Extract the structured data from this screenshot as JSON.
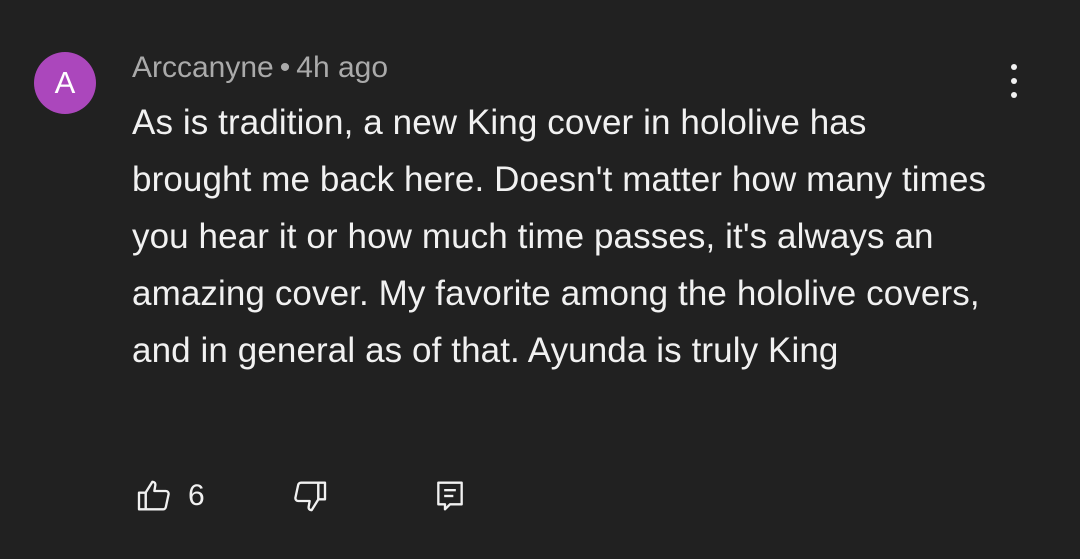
{
  "comment": {
    "avatar_letter": "A",
    "avatar_color": "#ab47bc",
    "author": "Arccanyne",
    "separator": "•",
    "time": "4h ago",
    "text": "As is tradition, a new King cover in hololive has brought me back here. Doesn't matter how many times you hear it or how much time passes, it's always an amazing cover. My favorite among the hololive covers, and in general as of that. Ayunda is truly King",
    "like_count": "6"
  },
  "icons": {
    "more": "more-vert-icon",
    "like": "thumbs-up-icon",
    "dislike": "thumbs-down-icon",
    "reply": "reply-comment-icon"
  }
}
